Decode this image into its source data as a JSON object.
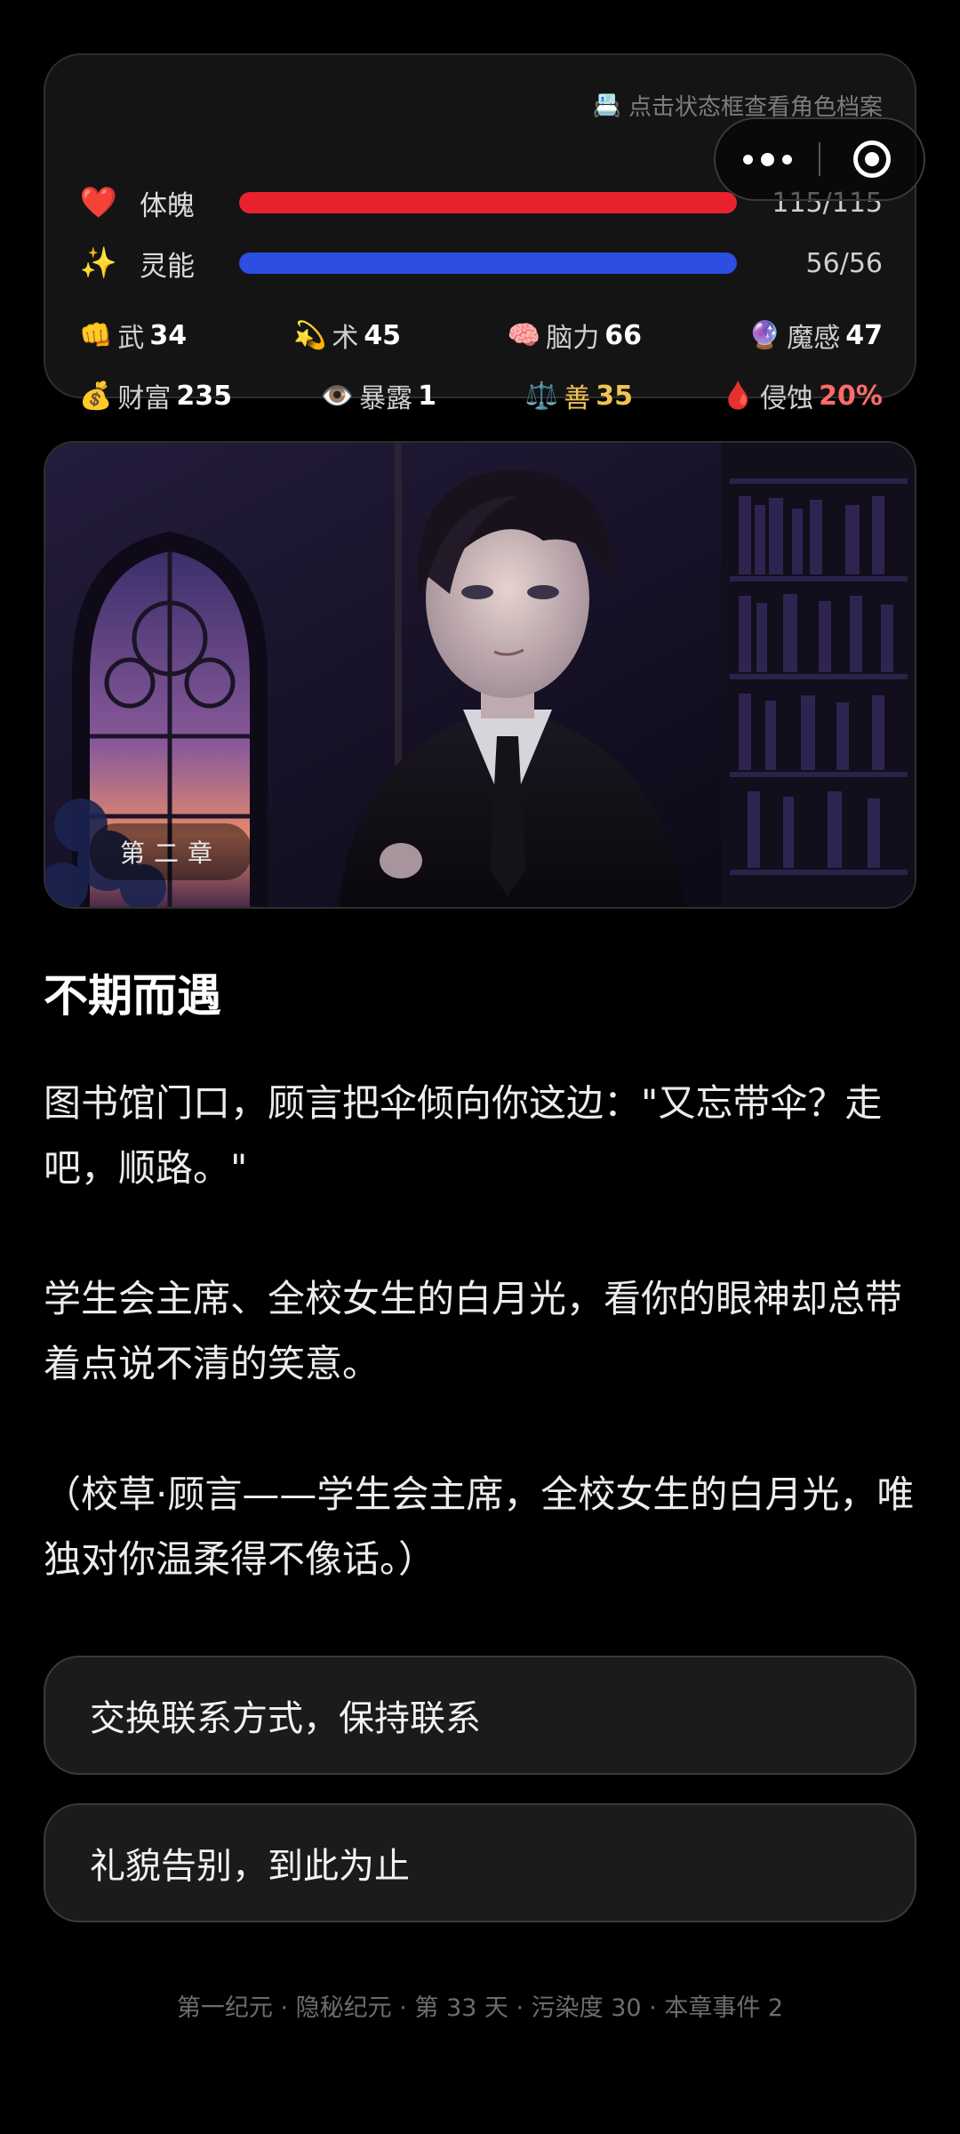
{
  "stats": {
    "profile_hint": "点击状态框查看角色档案",
    "hp": {
      "icon": "heart-icon",
      "label": "体魄",
      "value_text": "115/115",
      "current": 115,
      "max": 115,
      "color": "#e8232f"
    },
    "sp": {
      "icon": "sparkles-icon",
      "label": "灵能",
      "value_text": "56/56",
      "current": 56,
      "max": 56,
      "color": "#2d4ee0"
    },
    "attributes_row1": [
      {
        "icon": "fist-icon",
        "glyph": "👊",
        "label": "武",
        "value": "34"
      },
      {
        "icon": "dizzy-star-icon",
        "glyph": "💫",
        "label": "术",
        "value": "45"
      },
      {
        "icon": "brain-icon",
        "glyph": "🧠",
        "label": "脑力",
        "value": "66"
      },
      {
        "icon": "crystal-ball-icon",
        "glyph": "🔮",
        "label": "魔感",
        "value": "47"
      }
    ],
    "attributes_row2": [
      {
        "icon": "money-bag-icon",
        "glyph": "💰",
        "label": "财富",
        "value": "235"
      },
      {
        "icon": "eye-icon",
        "glyph": "👁️",
        "label": "暴露",
        "value": "1"
      },
      {
        "icon": "scales-icon",
        "glyph": "⚖️",
        "label": "善",
        "value": "35"
      },
      {
        "icon": "blood-drop-icon",
        "glyph": "🩸",
        "label": "侵蚀",
        "value": "20%"
      }
    ]
  },
  "chapter": {
    "label": "第二章"
  },
  "story": {
    "title": "不期而遇",
    "paragraphs": [
      "图书馆门口，顾言把伞倾向你这边：\"又忘带伞？走吧，顺路。\"",
      "学生会主席、全校女生的白月光，看你的眼神却总带着点说不清的笑意。",
      "（校草·顾言——学生会主席，全校女生的白月光，唯独对你温柔得不像话。）"
    ]
  },
  "choices": [
    "交换联系方式，保持联系",
    "礼貌告别，到此为止"
  ],
  "footer": {
    "status": "第一纪元 · 隐秘纪元 · 第 33 天 · 污染度 30 · 本章事件 2"
  },
  "colors": {
    "background": "#000000",
    "panel": "#141414",
    "gold": "#f1c451",
    "corrosion": "#ff6b6b"
  }
}
